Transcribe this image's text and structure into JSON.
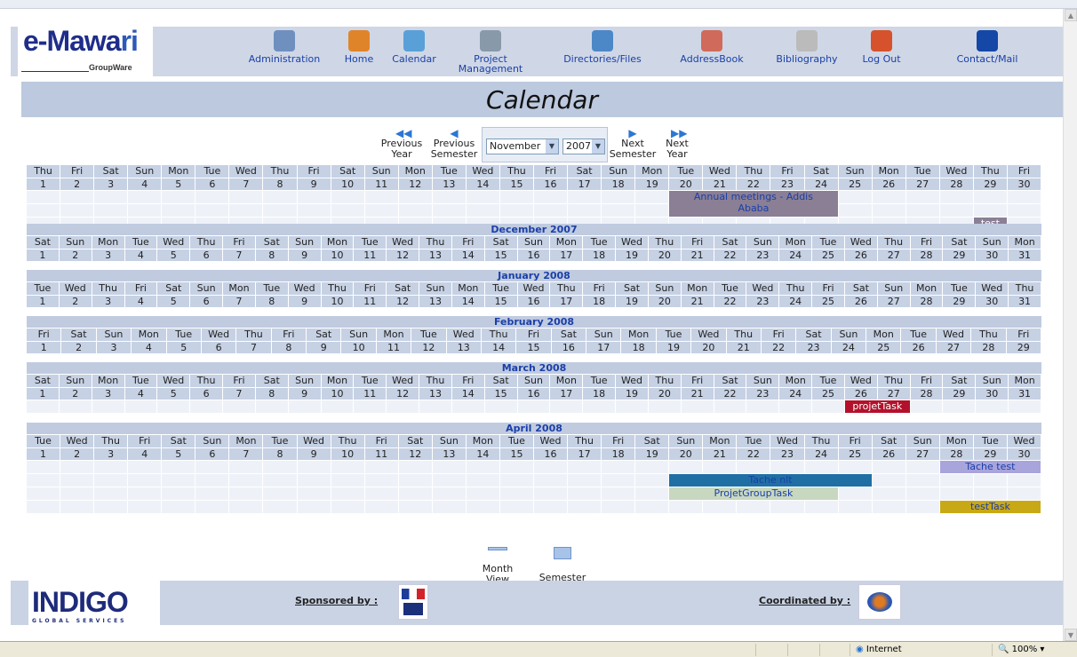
{
  "logo": {
    "brand_main": "e-Mawa",
    "brand_ri": "ri",
    "subtitle": "GroupWare"
  },
  "nav": [
    {
      "label": "Administration",
      "icon": "admin-icon",
      "color": "#6f8fbf"
    },
    {
      "label": "Home",
      "icon": "home-icon",
      "color": "#e0842a"
    },
    {
      "label": "Calendar",
      "icon": "calendar-icon",
      "color": "#5aa0d8"
    },
    {
      "label": "Project\nManagement",
      "icon": "project-icon",
      "color": "#8899aa"
    },
    {
      "label": "Directories/Files",
      "icon": "directory-icon",
      "color": "#4c88c7"
    },
    {
      "label": "AddressBook",
      "icon": "addressbook-icon",
      "color": "#d06a5a"
    },
    {
      "label": "Bibliography",
      "icon": "bibliography-icon",
      "color": "#bbbbbb"
    },
    {
      "label": "Log Out",
      "icon": "logout-icon",
      "color": "#d6522c"
    },
    {
      "label": "Contact/Mail",
      "icon": "help-icon",
      "color": "#1447a6"
    }
  ],
  "page_title": "Calendar",
  "navigation": {
    "prev_year": "Previous\nYear",
    "prev_semester": "Previous\nSemester",
    "next_semester": "Next\nSemester",
    "next_year": "Next\nYear",
    "month_value": "November",
    "year_value": "2007"
  },
  "months": [
    {
      "header": "",
      "days": [
        "Thu",
        "Fri",
        "Sat",
        "Sun",
        "Mon",
        "Tue",
        "Wed",
        "Thu",
        "Fri",
        "Sat",
        "Sun",
        "Mon",
        "Tue",
        "Wed",
        "Thu",
        "Fri",
        "Sat",
        "Sun",
        "Mon",
        "Tue",
        "Wed",
        "Thu",
        "Fri",
        "Sat",
        "Sun",
        "Mon",
        "Tue",
        "Wed",
        "Thu",
        "Fri"
      ],
      "count": 30
    },
    {
      "header": "December 2007",
      "days": [
        "Sat",
        "Sun",
        "Mon",
        "Tue",
        "Wed",
        "Thu",
        "Fri",
        "Sat",
        "Sun",
        "Mon",
        "Tue",
        "Wed",
        "Thu",
        "Fri",
        "Sat",
        "Sun",
        "Mon",
        "Tue",
        "Wed",
        "Thu",
        "Fri",
        "Sat",
        "Sun",
        "Mon",
        "Tue",
        "Wed",
        "Thu",
        "Fri",
        "Sat",
        "Sun",
        "Mon"
      ],
      "count": 31
    },
    {
      "header": "January 2008",
      "days": [
        "Tue",
        "Wed",
        "Thu",
        "Fri",
        "Sat",
        "Sun",
        "Mon",
        "Tue",
        "Wed",
        "Thu",
        "Fri",
        "Sat",
        "Sun",
        "Mon",
        "Tue",
        "Wed",
        "Thu",
        "Fri",
        "Sat",
        "Sun",
        "Mon",
        "Tue",
        "Wed",
        "Thu",
        "Fri",
        "Sat",
        "Sun",
        "Mon",
        "Tue",
        "Wed",
        "Thu"
      ],
      "count": 31
    },
    {
      "header": "February 2008",
      "days": [
        "Fri",
        "Sat",
        "Sun",
        "Mon",
        "Tue",
        "Wed",
        "Thu",
        "Fri",
        "Sat",
        "Sun",
        "Mon",
        "Tue",
        "Wed",
        "Thu",
        "Fri",
        "Sat",
        "Sun",
        "Mon",
        "Tue",
        "Wed",
        "Thu",
        "Fri",
        "Sat",
        "Sun",
        "Mon",
        "Tue",
        "Wed",
        "Thu",
        "Fri"
      ],
      "count": 29
    },
    {
      "header": "March 2008",
      "days": [
        "Sat",
        "Sun",
        "Mon",
        "Tue",
        "Wed",
        "Thu",
        "Fri",
        "Sat",
        "Sun",
        "Mon",
        "Tue",
        "Wed",
        "Thu",
        "Fri",
        "Sat",
        "Sun",
        "Mon",
        "Tue",
        "Wed",
        "Thu",
        "Fri",
        "Sat",
        "Sun",
        "Mon",
        "Tue",
        "Wed",
        "Thu",
        "Fri",
        "Sat",
        "Sun",
        "Mon"
      ],
      "count": 31
    },
    {
      "header": "April 2008",
      "days": [
        "Tue",
        "Wed",
        "Thu",
        "Fri",
        "Sat",
        "Sun",
        "Mon",
        "Tue",
        "Wed",
        "Thu",
        "Fri",
        "Sat",
        "Sun",
        "Mon",
        "Tue",
        "Wed",
        "Thu",
        "Fri",
        "Sat",
        "Sun",
        "Mon",
        "Tue",
        "Wed",
        "Thu",
        "Fri",
        "Sat",
        "Sun",
        "Mon",
        "Tue",
        "Wed"
      ],
      "count": 30
    }
  ],
  "events": {
    "annual": {
      "label": "Annual meetings - Addis\nAbaba",
      "color": "#8a7f95"
    },
    "test": {
      "label": "test",
      "color": "#8a7f95"
    },
    "projet": {
      "label": "projetTask",
      "color": "#b3112b"
    },
    "tache_test": {
      "label": "Tache test",
      "color": "#a8a4dc"
    },
    "tache_nlt": {
      "label": "Tache nlt",
      "color": "#1f6fa4"
    },
    "projet_group": {
      "label": "ProjetGroupTask",
      "color": "#c8d8c0"
    },
    "testtask": {
      "label": "testTask",
      "color": "#c9a816"
    }
  },
  "views": {
    "month": "Month\nView",
    "semester": "Semester\nView"
  },
  "footer": {
    "brand": "INDIGO",
    "brand_sub": "GLOBAL SERVICES",
    "sponsored": "Sponsored by :",
    "coordinated": "Coordinated by :"
  },
  "status": {
    "zone": "Internet",
    "zoom": "100%"
  }
}
